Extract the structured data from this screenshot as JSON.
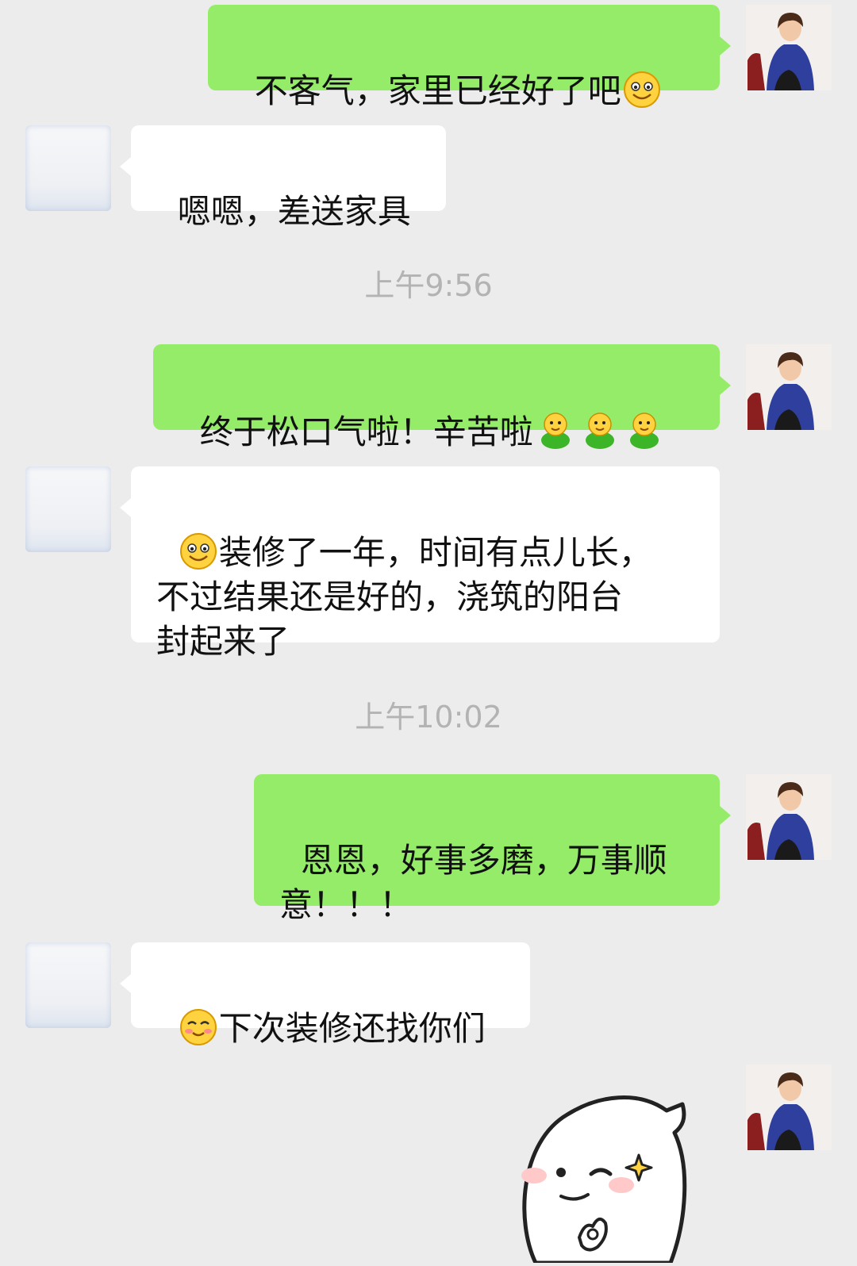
{
  "messages": [
    {
      "side": "right",
      "text": "不客气，家里已经好了吧",
      "trailing_emoji": "smile-icon"
    },
    {
      "side": "left",
      "text": "嗯嗯，差送家具"
    },
    {
      "side": "right",
      "text": "终于松口气啦！辛苦啦",
      "trailing_emoji": "green-baby-icon",
      "trailing_emoji_count": 3
    },
    {
      "side": "left",
      "leading_emoji": "smile-icon",
      "text": "装修了一年，时间有点儿长，\n不过结果还是好的，浇筑的阳台\n封起来了"
    },
    {
      "side": "right",
      "text": "恩恩，好事多磨，万事顺\n意！！！"
    },
    {
      "side": "left",
      "leading_emoji": "blush-icon",
      "text": "下次装修还找你们"
    },
    {
      "side": "right",
      "sticker": "wink-ok-sticker"
    }
  ],
  "timestamps": [
    "上午9:56",
    "上午10:02"
  ],
  "colors": {
    "background": "#ececec",
    "bubble_self": "#95ec69",
    "bubble_other": "#ffffff",
    "timestamp_text": "#b3b3b3"
  }
}
